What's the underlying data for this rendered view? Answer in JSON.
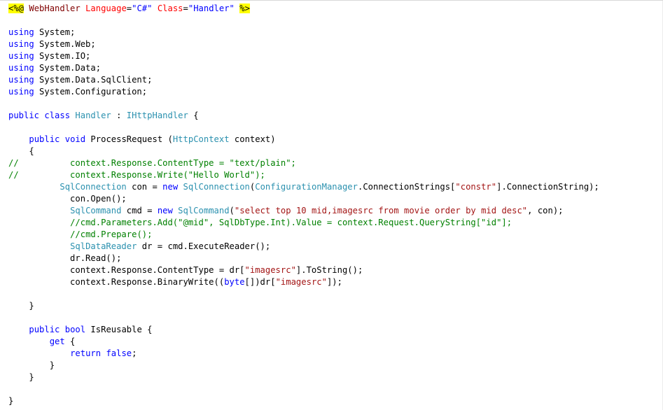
{
  "editor": {
    "language": "C#",
    "colors": {
      "keyword": "#0000ff",
      "type": "#2b91af",
      "string": "#a31515",
      "comment": "#008000",
      "directive_highlight": "#ffff00",
      "attribute_name": "#ff0000",
      "attribute_value": "#0000ff",
      "directive_name": "#800000"
    },
    "lines": [
      [
        [
          "directive",
          "<%@"
        ],
        [
          "plain",
          " "
        ],
        [
          "dirname",
          "WebHandler"
        ],
        [
          "plain",
          " "
        ],
        [
          "attrname",
          "Language"
        ],
        [
          "plain",
          "="
        ],
        [
          "attrval",
          "\"C#\""
        ],
        [
          "plain",
          " "
        ],
        [
          "attrname",
          "Class"
        ],
        [
          "plain",
          "="
        ],
        [
          "attrval",
          "\"Handler\""
        ],
        [
          "plain",
          " "
        ],
        [
          "directive",
          "%>"
        ]
      ],
      [],
      [
        [
          "kw",
          "using"
        ],
        [
          "plain",
          " System;"
        ]
      ],
      [
        [
          "kw",
          "using"
        ],
        [
          "plain",
          " System.Web;"
        ]
      ],
      [
        [
          "kw",
          "using"
        ],
        [
          "plain",
          " System.IO;"
        ]
      ],
      [
        [
          "kw",
          "using"
        ],
        [
          "plain",
          " System.Data;"
        ]
      ],
      [
        [
          "kw",
          "using"
        ],
        [
          "plain",
          " System.Data.SqlClient;"
        ]
      ],
      [
        [
          "kw",
          "using"
        ],
        [
          "plain",
          " System.Configuration;"
        ]
      ],
      [],
      [
        [
          "kw",
          "public"
        ],
        [
          "plain",
          " "
        ],
        [
          "kw",
          "class"
        ],
        [
          "plain",
          " "
        ],
        [
          "type",
          "Handler"
        ],
        [
          "plain",
          " : "
        ],
        [
          "type",
          "IHttpHandler"
        ],
        [
          "plain",
          " {"
        ]
      ],
      [],
      [
        [
          "plain",
          "    "
        ],
        [
          "kw",
          "public"
        ],
        [
          "plain",
          " "
        ],
        [
          "kw",
          "void"
        ],
        [
          "plain",
          " ProcessRequest ("
        ],
        [
          "type",
          "HttpContext"
        ],
        [
          "plain",
          " context)"
        ]
      ],
      [
        [
          "plain",
          "    {"
        ]
      ],
      [
        [
          "comment",
          "//          context.Response.ContentType = \"text/plain\";"
        ]
      ],
      [
        [
          "comment",
          "//          context.Response.Write(\"Hello World\");"
        ]
      ],
      [
        [
          "plain",
          "          "
        ],
        [
          "type",
          "SqlConnection"
        ],
        [
          "plain",
          " con = "
        ],
        [
          "kw",
          "new"
        ],
        [
          "plain",
          " "
        ],
        [
          "type",
          "SqlConnection"
        ],
        [
          "plain",
          "("
        ],
        [
          "type",
          "ConfigurationManager"
        ],
        [
          "plain",
          ".ConnectionStrings["
        ],
        [
          "str",
          "\"constr\""
        ],
        [
          "plain",
          "].ConnectionString);"
        ]
      ],
      [
        [
          "plain",
          "            con.Open();"
        ]
      ],
      [
        [
          "plain",
          "            "
        ],
        [
          "type",
          "SqlCommand"
        ],
        [
          "plain",
          " cmd = "
        ],
        [
          "kw",
          "new"
        ],
        [
          "plain",
          " "
        ],
        [
          "type",
          "SqlCommand"
        ],
        [
          "plain",
          "("
        ],
        [
          "str",
          "\"select top 10 mid,imagesrc from movie order by mid desc\""
        ],
        [
          "plain",
          ", con);"
        ]
      ],
      [
        [
          "plain",
          "            "
        ],
        [
          "comment",
          "//cmd.Parameters.Add(\"@mid\", SqlDbType.Int).Value = context.Request.QueryString[\"id\"];"
        ]
      ],
      [
        [
          "plain",
          "            "
        ],
        [
          "comment",
          "//cmd.Prepare();"
        ]
      ],
      [
        [
          "plain",
          "            "
        ],
        [
          "type",
          "SqlDataReader"
        ],
        [
          "plain",
          " dr = cmd.ExecuteReader();"
        ]
      ],
      [
        [
          "plain",
          "            dr.Read();"
        ]
      ],
      [
        [
          "plain",
          "            context.Response.ContentType = dr["
        ],
        [
          "str",
          "\"imagesrc\""
        ],
        [
          "plain",
          "].ToString();"
        ]
      ],
      [
        [
          "plain",
          "            context.Response.BinaryWrite(("
        ],
        [
          "kw",
          "byte"
        ],
        [
          "plain",
          "[])dr["
        ],
        [
          "str",
          "\"imagesrc\""
        ],
        [
          "plain",
          "]);"
        ]
      ],
      [],
      [
        [
          "plain",
          "    }"
        ]
      ],
      [],
      [
        [
          "plain",
          "    "
        ],
        [
          "kw",
          "public"
        ],
        [
          "plain",
          " "
        ],
        [
          "kw",
          "bool"
        ],
        [
          "plain",
          " IsReusable {"
        ]
      ],
      [
        [
          "plain",
          "        "
        ],
        [
          "kw",
          "get"
        ],
        [
          "plain",
          " {"
        ]
      ],
      [
        [
          "plain",
          "            "
        ],
        [
          "kw",
          "return"
        ],
        [
          "plain",
          " "
        ],
        [
          "kw",
          "false"
        ],
        [
          "plain",
          ";"
        ]
      ],
      [
        [
          "plain",
          "        }"
        ]
      ],
      [
        [
          "plain",
          "    }"
        ]
      ],
      [],
      [
        [
          "plain",
          "}"
        ]
      ]
    ]
  }
}
